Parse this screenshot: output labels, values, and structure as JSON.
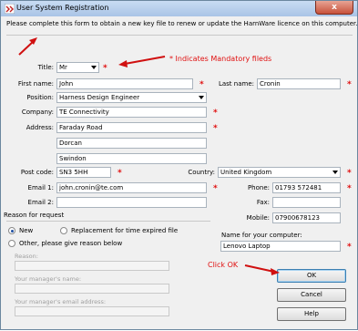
{
  "window": {
    "title": "User System Registration",
    "close_label": "x"
  },
  "intro": "Please complete this form to obtain a new key file to renew or update the HarnWare licence on this computer.",
  "annotations": {
    "mandatory": "* Indicates Mandatory fileds",
    "click_ok": "Click OK"
  },
  "fields": {
    "title_label": "Title:",
    "title_value": "Mr",
    "first_name_label": "First name:",
    "first_name_value": "John",
    "last_name_label": "Last name:",
    "last_name_value": "Cronin",
    "position_label": "Position:",
    "position_value": "Harness Design Engineer",
    "company_label": "Company:",
    "company_value": "TE Connectivity",
    "address_label": "Address:",
    "address1": "Faraday Road",
    "address2": "Dorcan",
    "address3": "Swindon",
    "postcode_label": "Post code:",
    "postcode_value": "SN3 5HH",
    "country_label": "Country:",
    "country_value": "United Kingdom",
    "email1_label": "Email 1:",
    "email1_value": "john.cronin@te.com",
    "email2_label": "Email 2:",
    "email2_value": "",
    "phone_label": "Phone:",
    "phone_value": "01793 572481",
    "fax_label": "Fax:",
    "fax_value": "",
    "mobile_label": "Mobile:",
    "mobile_value": "07900678123"
  },
  "request": {
    "group_label": "Reason for request",
    "option_new": "New",
    "option_replacement": "Replacement for time expired file",
    "option_other": "Other, please give reason below",
    "reason_label": "Reason:",
    "manager_name_label": "Your manager's name:",
    "manager_email_label": "Your manager's email address:"
  },
  "computer": {
    "label": "Name for your computer:",
    "value": "Lenovo Laptop"
  },
  "buttons": {
    "ok": "OK",
    "cancel": "Cancel",
    "help": "Help"
  },
  "colors": {
    "accent_red": "#e01010",
    "title_bar": "#c9dcf3"
  }
}
